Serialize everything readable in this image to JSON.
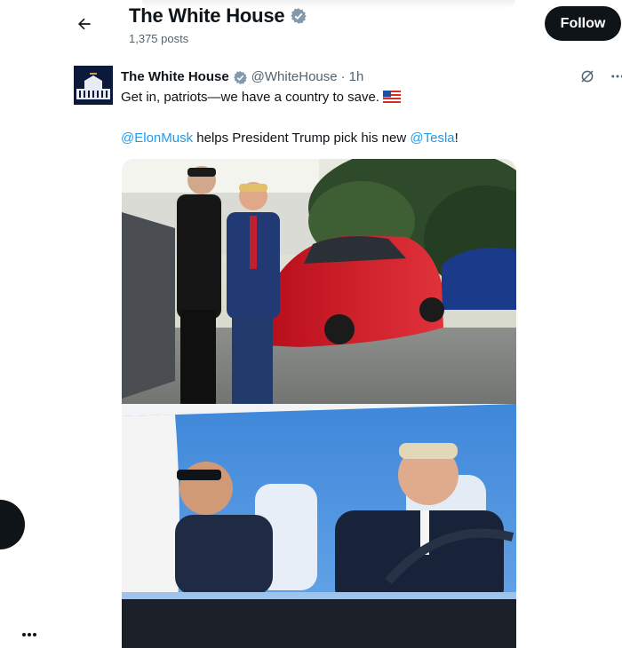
{
  "header": {
    "title": "The White House",
    "post_count": "1,375 posts",
    "follow_label": "Follow"
  },
  "post": {
    "author_name": "The White House",
    "handle": "@WhiteHouse",
    "separator": "·",
    "time": "1h",
    "line1": "Get in, patriots—we have a country to save.",
    "flag_icon": "us-flag-icon",
    "mention_elon": "@ElonMusk",
    "line2_middle": " helps President Trump pick his new ",
    "mention_tesla": "@Tesla",
    "line2_end": "!"
  },
  "icons": {
    "back": "arrow-left-icon",
    "verified": "verified-badge-icon",
    "grok": "grok-icon",
    "more": "more-horizontal-icon"
  },
  "colors": {
    "accent": "#1d9bf0",
    "verified": "#829aab",
    "follow_bg": "#0f1419"
  }
}
